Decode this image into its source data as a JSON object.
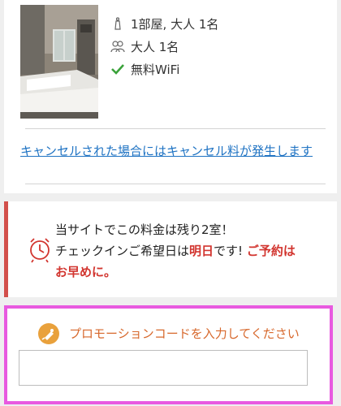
{
  "room": {
    "features": [
      {
        "icon": "bed-icon",
        "text": "1部屋, 大人 1名"
      },
      {
        "icon": "guests-icon",
        "text": "大人 1名"
      },
      {
        "icon": "check-icon",
        "text": "無料WiFi"
      }
    ],
    "cancel_link": "キャンセルされた場合にはキャンセル料が発生します"
  },
  "notice": {
    "line1": "当サイトでこの料金は残り2室！",
    "line2_prefix": "チェックインご希望日は",
    "line2_highlight": "明日",
    "line2_mid": "です! ",
    "line2_urgent": "ご予約は",
    "line3_urgent": "お早めに。"
  },
  "promo": {
    "label": "プロモーションコードを入力してください",
    "input_value": ""
  },
  "colors": {
    "link": "#1f73c3",
    "alert": "#d2352f",
    "promo_label": "#d7682c",
    "check": "#3aa23a",
    "highlight_border": "#e85ae0"
  }
}
